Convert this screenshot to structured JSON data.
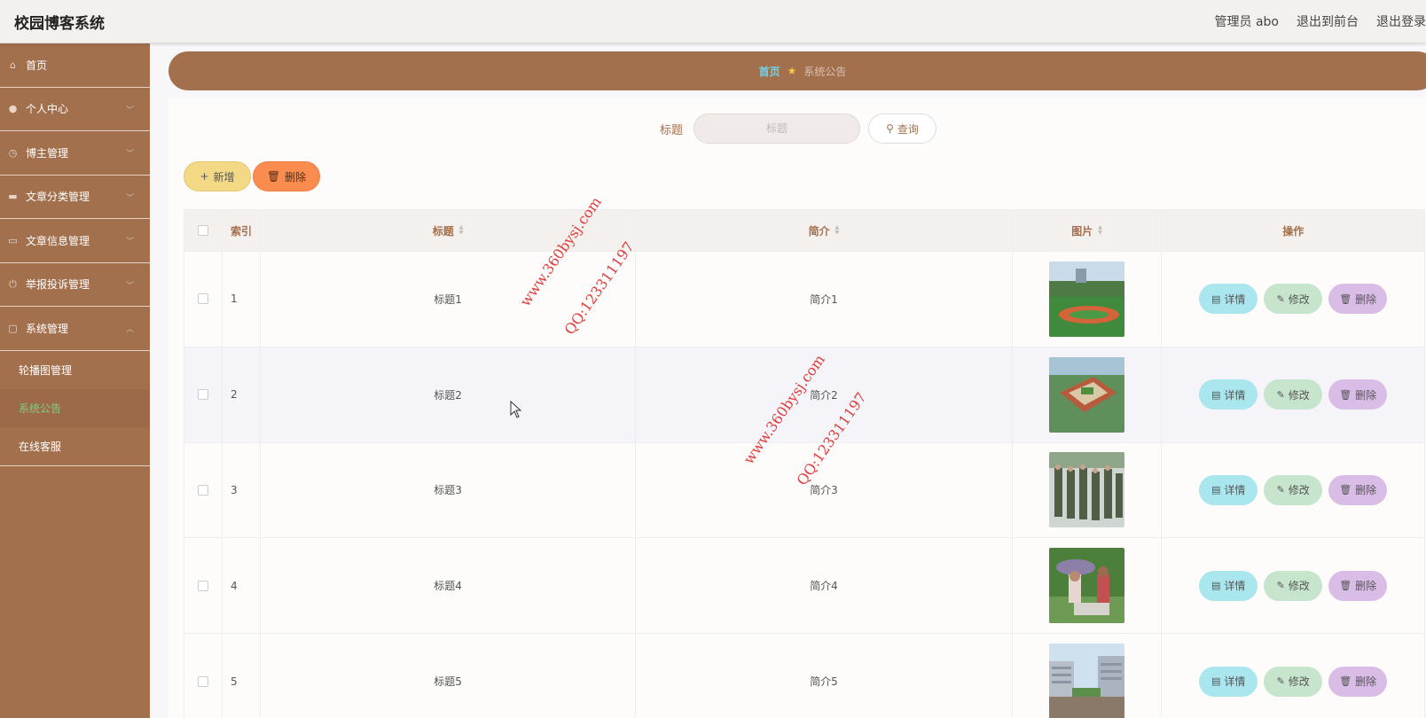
{
  "header": {
    "app_title": "校园博客系统",
    "links": [
      "管理员 abo",
      "退出到前台",
      "退出登录"
    ]
  },
  "sidebar": {
    "items": [
      {
        "label": "首页",
        "icon": "home-icon"
      },
      {
        "label": "个人中心",
        "icon": "user-icon"
      },
      {
        "label": "博主管理",
        "icon": "clock-icon"
      },
      {
        "label": "文章分类管理",
        "icon": "ticket-icon"
      },
      {
        "label": "文章信息管理",
        "icon": "monitor-icon"
      },
      {
        "label": "举报投诉管理",
        "icon": "power-icon"
      },
      {
        "label": "系统管理",
        "icon": "message-icon"
      }
    ],
    "sub_items": [
      "轮播图管理",
      "系统公告",
      "在线客服"
    ],
    "active_sub": "系统公告"
  },
  "breadcrumb": {
    "home": "首页",
    "current": "系统公告"
  },
  "search": {
    "label": "标题",
    "placeholder": "标题",
    "button": "查询"
  },
  "actions": {
    "add": "新增",
    "delete": "删除"
  },
  "table": {
    "columns": [
      "索引",
      "标题",
      "简介",
      "图片",
      "操作"
    ],
    "rows": [
      {
        "index": "1",
        "title": "标题1",
        "brief": "简介1",
        "image": "sports-field"
      },
      {
        "index": "2",
        "title": "标题2",
        "brief": "简介2",
        "image": "campus-aerial"
      },
      {
        "index": "3",
        "title": "标题3",
        "brief": "简介3",
        "image": "military-training"
      },
      {
        "index": "4",
        "title": "标题4",
        "brief": "简介4",
        "image": "students-umbrella"
      },
      {
        "index": "5",
        "title": "标题5",
        "brief": "简介5",
        "image": "modern-building"
      }
    ],
    "ops": {
      "detail": "详情",
      "edit": "修改",
      "remove": "删除"
    }
  },
  "watermarks": [
    "www.360bysj.com",
    "QQ:123311197"
  ],
  "colors": {
    "primary": "#a3704e",
    "active_menu": "#7ed07f",
    "crumb_home": "#6fd3e8",
    "add_btn": "#f3d985",
    "delete_btn": "#fb8c4f"
  }
}
